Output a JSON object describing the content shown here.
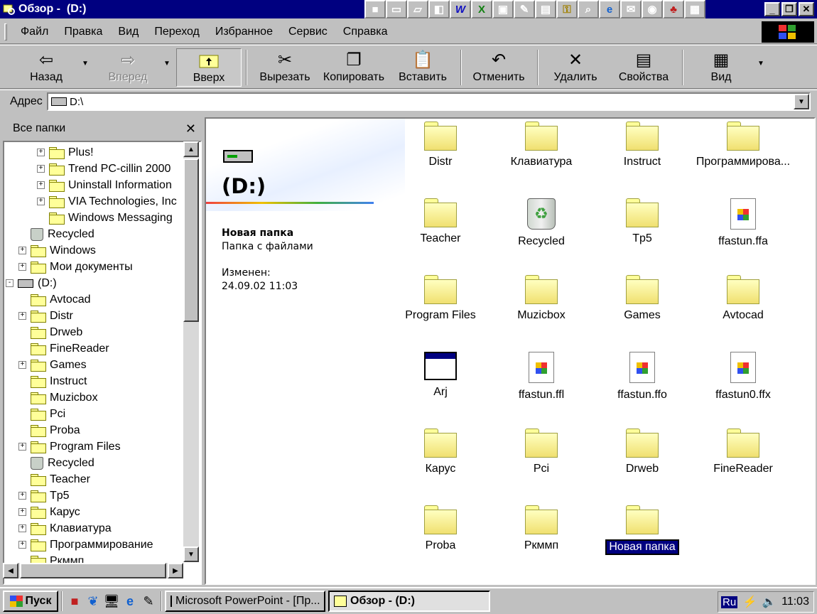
{
  "window": {
    "title": "Обзор -  (D:)"
  },
  "menu": [
    "Файл",
    "Правка",
    "Вид",
    "Переход",
    "Избранное",
    "Сервис",
    "Справка"
  ],
  "toolbar": {
    "back": "Назад",
    "forward": "Вперед",
    "up": "Вверх",
    "cut": "Вырезать",
    "copy": "Копировать",
    "paste": "Вставить",
    "undo": "Отменить",
    "delete": "Удалить",
    "properties": "Свойства",
    "view": "Вид"
  },
  "address": {
    "label": "Адрес",
    "value": "D:\\"
  },
  "folders_pane": {
    "title": "Все папки",
    "items": [
      {
        "label": "Plus!",
        "indent": 2,
        "expander": "+",
        "icon": "folder-icon"
      },
      {
        "label": "Trend PC-cillin 2000",
        "indent": 2,
        "expander": "+",
        "icon": "folder-icon"
      },
      {
        "label": "Uninstall Information",
        "indent": 2,
        "expander": "+",
        "icon": "folder-icon"
      },
      {
        "label": "VIA Technologies, Inc",
        "indent": 2,
        "expander": "+",
        "icon": "folder-icon"
      },
      {
        "label": "Windows Messaging",
        "indent": 2,
        "expander": "",
        "icon": "folder-icon"
      },
      {
        "label": "Recycled",
        "indent": 1,
        "expander": "",
        "icon": "recycle-bin-icon"
      },
      {
        "label": "Windows",
        "indent": 1,
        "expander": "+",
        "icon": "folder-icon"
      },
      {
        "label": "Мои документы",
        "indent": 1,
        "expander": "+",
        "icon": "folder-icon"
      },
      {
        "label": "(D:)",
        "indent": 0,
        "expander": "-",
        "icon": "drive-icon"
      },
      {
        "label": "Avtocad",
        "indent": 1,
        "expander": "",
        "icon": "folder-icon"
      },
      {
        "label": "Distr",
        "indent": 1,
        "expander": "+",
        "icon": "folder-icon"
      },
      {
        "label": "Drweb",
        "indent": 1,
        "expander": "",
        "icon": "folder-icon"
      },
      {
        "label": "FineReader",
        "indent": 1,
        "expander": "",
        "icon": "folder-icon"
      },
      {
        "label": "Games",
        "indent": 1,
        "expander": "+",
        "icon": "folder-icon"
      },
      {
        "label": "Instruct",
        "indent": 1,
        "expander": "",
        "icon": "folder-icon"
      },
      {
        "label": "Muzicbox",
        "indent": 1,
        "expander": "",
        "icon": "folder-icon"
      },
      {
        "label": "Pci",
        "indent": 1,
        "expander": "",
        "icon": "folder-icon"
      },
      {
        "label": "Proba",
        "indent": 1,
        "expander": "",
        "icon": "folder-icon"
      },
      {
        "label": "Program Files",
        "indent": 1,
        "expander": "+",
        "icon": "folder-icon"
      },
      {
        "label": "Recycled",
        "indent": 1,
        "expander": "",
        "icon": "recycle-bin-icon"
      },
      {
        "label": "Teacher",
        "indent": 1,
        "expander": "",
        "icon": "folder-icon"
      },
      {
        "label": "Tp5",
        "indent": 1,
        "expander": "+",
        "icon": "folder-icon"
      },
      {
        "label": "Карус",
        "indent": 1,
        "expander": "+",
        "icon": "folder-icon"
      },
      {
        "label": "Клавиатура",
        "indent": 1,
        "expander": "+",
        "icon": "folder-icon"
      },
      {
        "label": "Программирование",
        "indent": 1,
        "expander": "+",
        "icon": "folder-icon"
      },
      {
        "label": "Ркммп",
        "indent": 1,
        "expander": "",
        "icon": "folder-icon"
      }
    ]
  },
  "details": {
    "drive_title": "(D:)",
    "selected_name": "Новая папка",
    "selected_type": "Папка с файлами",
    "modified_label": "Изменен:",
    "modified_value": "24.09.02 11:03"
  },
  "files": [
    {
      "label": "Distr",
      "icon": "folder-icon"
    },
    {
      "label": "Клавиатура",
      "icon": "folder-icon"
    },
    {
      "label": "Instruct",
      "icon": "folder-icon"
    },
    {
      "label": "Программирова...",
      "icon": "folder-icon"
    },
    {
      "label": "Teacher",
      "icon": "folder-icon"
    },
    {
      "label": "Recycled",
      "icon": "recycle-bin-icon"
    },
    {
      "label": "Tp5",
      "icon": "folder-icon"
    },
    {
      "label": "ffastun.ffa",
      "icon": "document-icon"
    },
    {
      "label": "Program Files",
      "icon": "folder-icon"
    },
    {
      "label": "Muzicbox",
      "icon": "folder-icon"
    },
    {
      "label": "Games",
      "icon": "folder-icon"
    },
    {
      "label": "Avtocad",
      "icon": "folder-icon"
    },
    {
      "label": "Arj",
      "icon": "application-icon"
    },
    {
      "label": "ffastun.ffl",
      "icon": "document-icon"
    },
    {
      "label": "ffastun.ffo",
      "icon": "document-icon"
    },
    {
      "label": "ffastun0.ffx",
      "icon": "document-icon"
    },
    {
      "label": "Карус",
      "icon": "folder-icon"
    },
    {
      "label": "Pci",
      "icon": "folder-icon"
    },
    {
      "label": "Drweb",
      "icon": "folder-icon"
    },
    {
      "label": "FineReader",
      "icon": "folder-icon"
    },
    {
      "label": "Proba",
      "icon": "folder-icon"
    },
    {
      "label": "Ркммп",
      "icon": "folder-icon"
    },
    {
      "label": "Новая папка",
      "icon": "folder-icon",
      "selected": true
    }
  ],
  "taskbar": {
    "start": "Пуск",
    "tasks": [
      {
        "label": "Microsoft PowerPoint - [Пр...",
        "active": false
      },
      {
        "label": "Обзор -  (D:)",
        "active": true
      }
    ],
    "language": "Ru",
    "clock": "11:03"
  },
  "colors": {
    "title_bar": "#000080",
    "face": "#c0c0c0",
    "selection": "#000080",
    "folder": "#ffff99"
  }
}
